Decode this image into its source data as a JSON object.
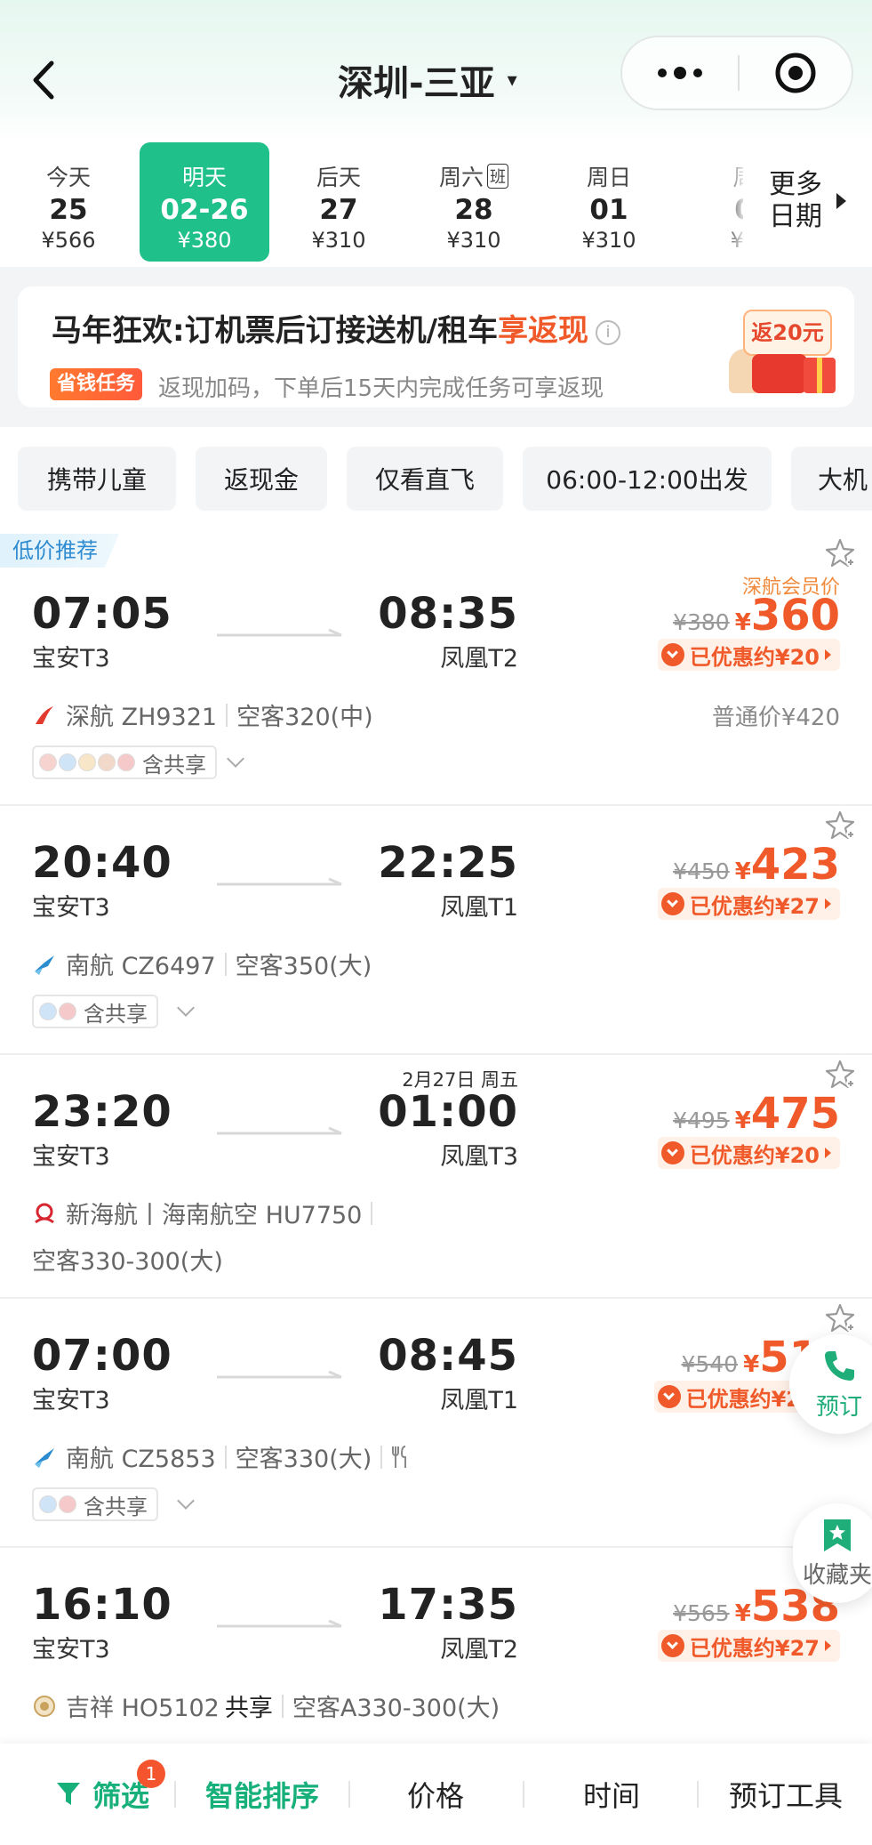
{
  "header": {
    "title": "深圳-三亚",
    "caret": "▾"
  },
  "colors": {
    "accent_green": "#1fc08a",
    "price_orange": "#f05a2a"
  },
  "dates": [
    {
      "label": "今天",
      "date": "25",
      "price": "¥566",
      "active": false
    },
    {
      "label": "明天",
      "date": "02-26",
      "price": "¥380",
      "active": true
    },
    {
      "label": "后天",
      "date": "27",
      "price": "¥310",
      "active": false
    },
    {
      "label": "周六",
      "badge": "班",
      "date": "28",
      "price": "¥310",
      "active": false
    },
    {
      "label": "周日",
      "date": "01",
      "price": "¥310",
      "active": false
    },
    {
      "label": "周",
      "date": "0",
      "price": "¥3",
      "active": false
    }
  ],
  "more_dates": "更多日期",
  "banner": {
    "title_prefix": "马年狂欢:订机票后订接送机/租车",
    "title_highlight": "享返现",
    "tag": "省钱任务",
    "subtitle": "返现加码，下单后15天内完成任务可享返现",
    "rebate": "返20元"
  },
  "filters": [
    "携带儿童",
    "返现金",
    "仅看直飞",
    "06:00-12:00出发",
    "大机"
  ],
  "flights": [
    {
      "recommend": "低价推荐",
      "dep_time": "07:05",
      "dep_airport": "宝安T3",
      "arr_time": "08:35",
      "arr_airport": "凤凰T2",
      "airline": "深航 ZH9321",
      "aircraft": "空客320(中)",
      "codeshare": "含共享",
      "member_label": "深航会员价",
      "old_price": "¥380",
      "yen": "¥",
      "price": "360",
      "discount": "已优惠约¥20",
      "regular": "普通价¥420"
    },
    {
      "dep_time": "20:40",
      "dep_airport": "宝安T3",
      "arr_time": "22:25",
      "arr_airport": "凤凰T1",
      "airline": "南航 CZ6497",
      "aircraft": "空客350(大)",
      "codeshare": "含共享",
      "old_price": "¥450",
      "yen": "¥",
      "price": "423",
      "discount": "已优惠约¥27"
    },
    {
      "next_day": "2月27日 周五",
      "dep_time": "23:20",
      "dep_airport": "宝安T3",
      "arr_time": "01:00",
      "arr_airport": "凤凰T3",
      "airline": "新海航丨海南航空 HU7750",
      "aircraft": "空客330-300(大)",
      "old_price": "¥495",
      "yen": "¥",
      "price": "475",
      "discount": "已优惠约¥20"
    },
    {
      "dep_time": "07:00",
      "dep_airport": "宝安T3",
      "arr_time": "08:45",
      "arr_airport": "凤凰T1",
      "airline": "南航 CZ5853",
      "aircraft": "空客330(大)",
      "codeshare": "含共享",
      "old_price": "¥540",
      "yen": "¥",
      "price": "51",
      "discount": "已优惠约¥2"
    },
    {
      "dep_time": "16:10",
      "dep_airport": "宝安T3",
      "arr_time": "17:35",
      "arr_airport": "凤凰T2",
      "airline": "吉祥 HO5102",
      "shared": "共享",
      "aircraft": "空客A330-300(大)",
      "old_price": "¥565",
      "yen": "¥",
      "price": "538",
      "discount": "已优惠约¥27"
    }
  ],
  "floating": {
    "book": "预订",
    "favorites": "收藏夹"
  },
  "bottom_bar": {
    "filter": "筛选",
    "filter_badge": "1",
    "smart_sort": "智能排序",
    "price": "价格",
    "time": "时间",
    "tools": "预订工具"
  }
}
